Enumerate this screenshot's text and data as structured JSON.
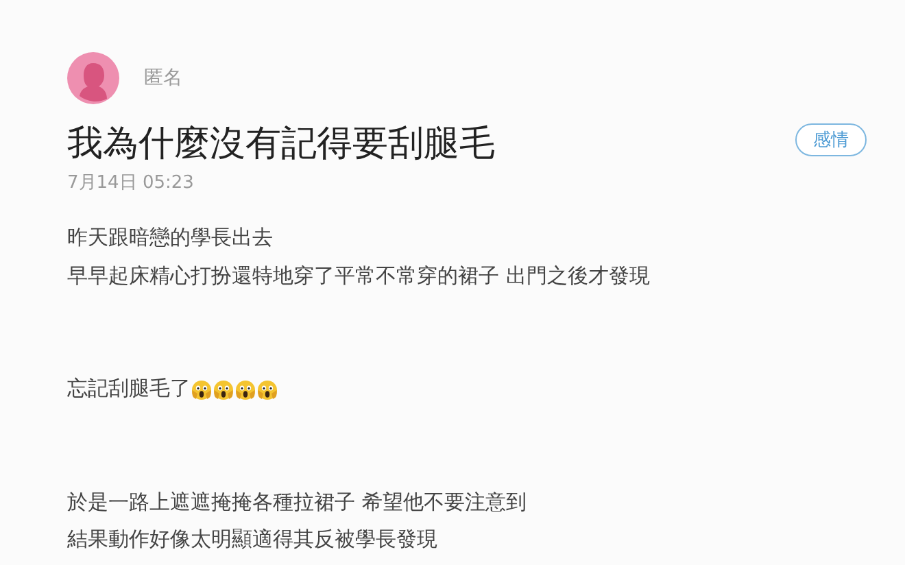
{
  "author": {
    "name": "匿名"
  },
  "post": {
    "title": "我為什麼沒有記得要刮腿毛",
    "date": "7月14日 05:23",
    "tag": "感情"
  },
  "body": [
    {
      "lines": [
        {
          "text": "昨天跟暗戀的學長出去"
        },
        {
          "text": "早早起床精心打扮還特地穿了平常不常穿的裙子 出門之後才發現"
        }
      ]
    },
    {
      "lines": [
        {
          "text": "忘記刮腿毛了",
          "icons": [
            {
              "kind": "scream"
            },
            {
              "kind": "scream"
            },
            {
              "kind": "scream"
            },
            {
              "kind": "scream"
            }
          ]
        }
      ]
    },
    {
      "lines": [
        {
          "text": "於是一路上遮遮掩掩各種拉裙子 希望他不要注意到"
        },
        {
          "text": "結果動作好像太明顯適得其反被學長發現"
        }
      ]
    }
  ]
}
